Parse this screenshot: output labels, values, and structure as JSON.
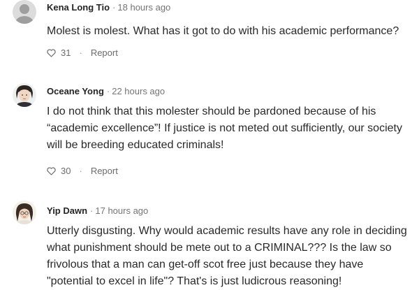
{
  "comments": [
    {
      "author": "Kena Long Tio",
      "separator": "·",
      "time": "18 hours ago",
      "lines": [
        "Molest is molest. What has it got to do with his academic performance?"
      ],
      "claps": "31",
      "dot": "·",
      "report_label": "Report"
    },
    {
      "author": "Oceane Yong",
      "separator": "·",
      "time": "22 hours ago",
      "lines": [
        "I do not think that this molester should be pardoned because of his",
        "“academic excellence”! If justice is not meted out sufficiently, our society",
        "will be breeding educated criminals!"
      ],
      "claps": "30",
      "dot": "·",
      "report_label": "Report"
    },
    {
      "author": "Yip Dawn",
      "separator": "·",
      "time": "17 hours ago",
      "lines": [
        "Utterly disgusting. Why would academic results have any role in deciding",
        "what punishment should be mete out to a CRIMINAL??? Is the law so",
        "frivolous that a man can get-off scot free just because they have",
        "\"potential to excel in life\"? That's is just ludicrous reasoning!"
      ]
    }
  ],
  "icons": {
    "avatar_default": "default-user-avatar",
    "heart": "heart-icon"
  },
  "colors": {
    "text": "#292929",
    "meta": "#757575",
    "avatar_placeholder": "#d9d9d9"
  }
}
